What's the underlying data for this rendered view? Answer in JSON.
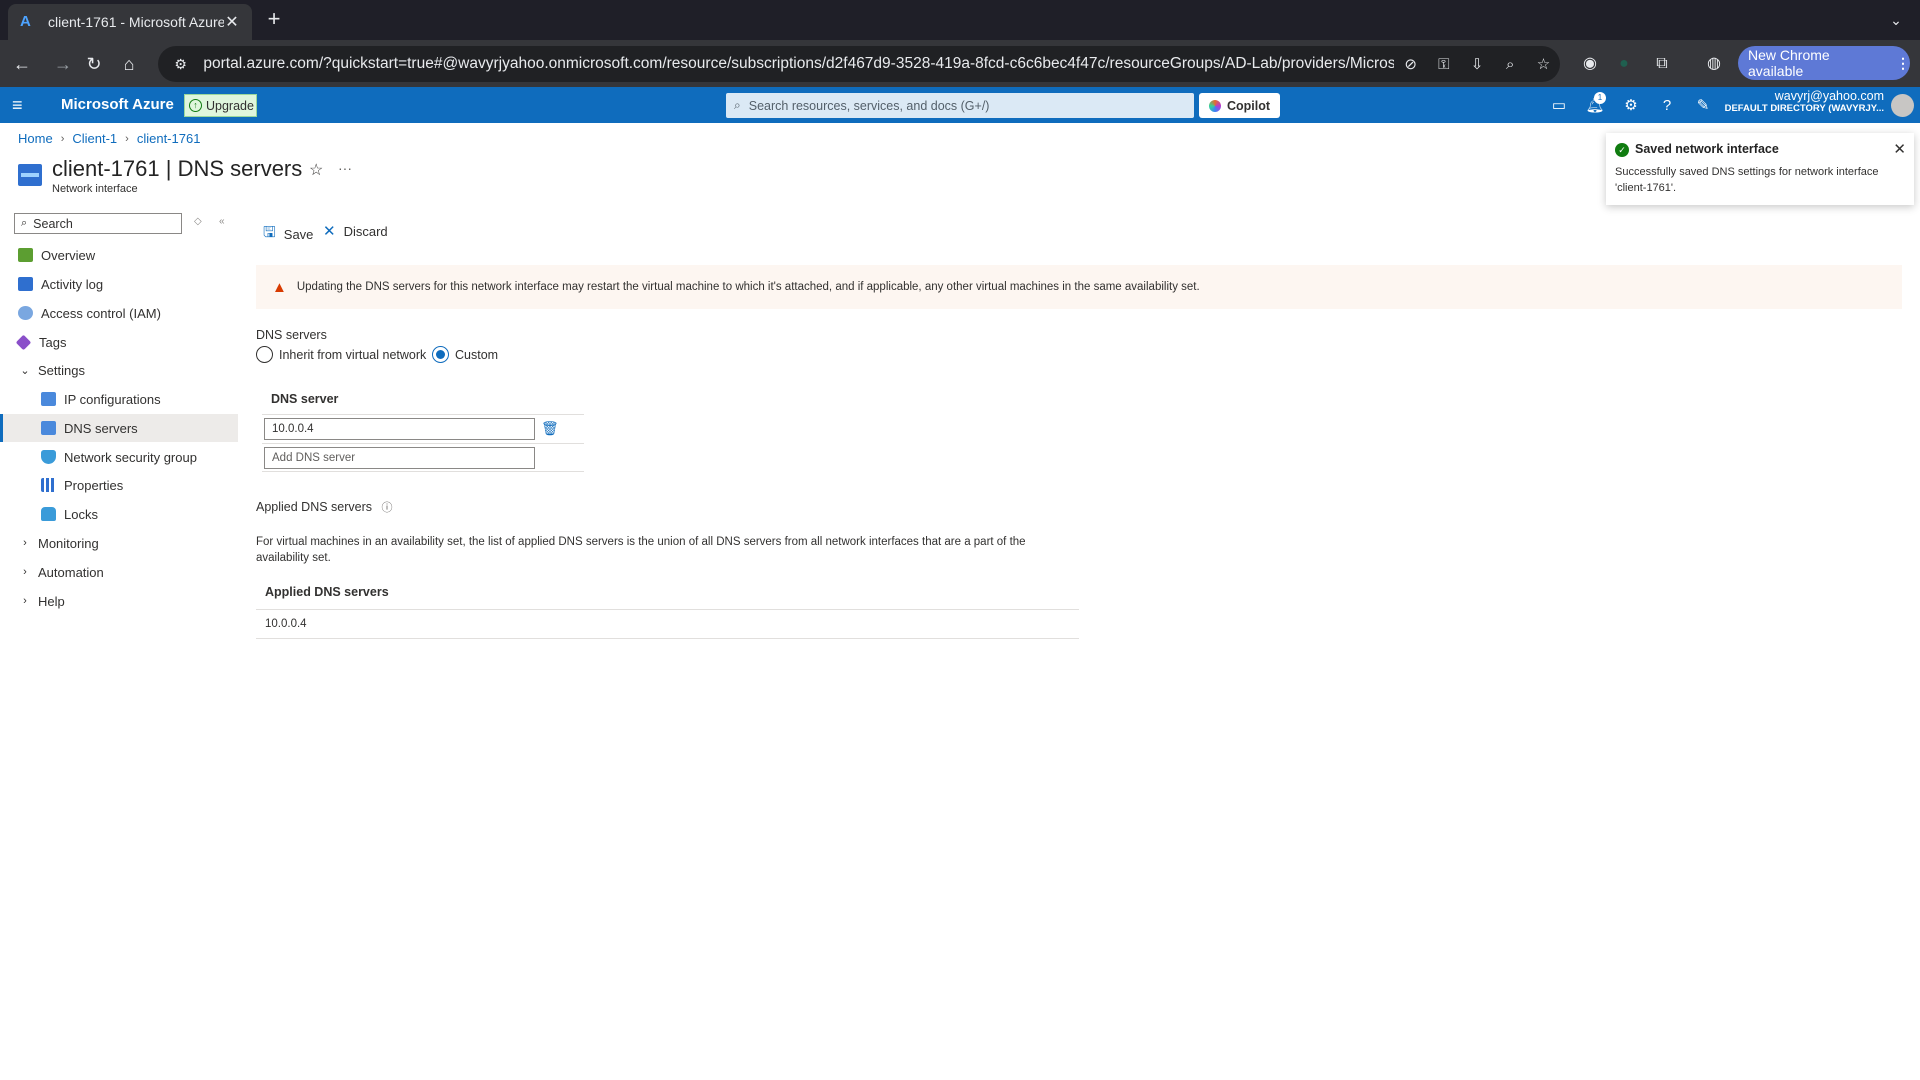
{
  "browser": {
    "tab_title": "client-1761 - Microsoft Azure",
    "url": "portal.azure.com/?quickstart=true#@wavyrjyahoo.onmicrosoft.com/resource/subscriptions/d2f467d9-3528-419a-8fcd-c6c6bec4f47c/resourceGroups/AD-Lab/providers/Microsof...",
    "update_button": "New Chrome available"
  },
  "header": {
    "brand": "Microsoft Azure",
    "upgrade": "Upgrade",
    "search_placeholder": "Search resources, services, and docs (G+/)",
    "copilot": "Copilot",
    "notification_count": "1",
    "account_email": "wavyrj@yahoo.com",
    "account_directory": "DEFAULT DIRECTORY (WAVYRJY..."
  },
  "breadcrumb": [
    "Home",
    "Client-1",
    "client-1761"
  ],
  "page": {
    "title": "client-1761 | DNS servers",
    "subtitle": "Network interface"
  },
  "sidebar": {
    "search_placeholder": "Search",
    "items": [
      {
        "label": "Overview"
      },
      {
        "label": "Activity log"
      },
      {
        "label": "Access control (IAM)"
      },
      {
        "label": "Tags"
      },
      {
        "label": "Settings"
      },
      {
        "label": "IP configurations"
      },
      {
        "label": "DNS servers"
      },
      {
        "label": "Network security group"
      },
      {
        "label": "Properties"
      },
      {
        "label": "Locks"
      },
      {
        "label": "Monitoring"
      },
      {
        "label": "Automation"
      },
      {
        "label": "Help"
      }
    ]
  },
  "commands": {
    "save": "Save",
    "discard": "Discard"
  },
  "warning": "Updating the DNS servers for this network interface may restart the virtual machine to which it's attached, and if applicable, any other virtual machines in the same availability set.",
  "dns": {
    "section_label": "DNS servers",
    "option_inherit": "Inherit from virtual network",
    "option_custom": "Custom",
    "selected_option": "Custom",
    "column_header": "DNS server",
    "servers": [
      "10.0.0.4"
    ],
    "add_placeholder": "Add DNS server"
  },
  "applied": {
    "label": "Applied DNS servers",
    "description": "For virtual machines in an availability set, the list of applied DNS servers is the union of all DNS servers from all network interfaces that are a part of the availability set.",
    "column_header": "Applied DNS servers",
    "rows": [
      "10.0.0.4"
    ]
  },
  "toast": {
    "title": "Saved network interface",
    "message": "Successfully saved DNS settings for network interface 'client-1761'."
  }
}
